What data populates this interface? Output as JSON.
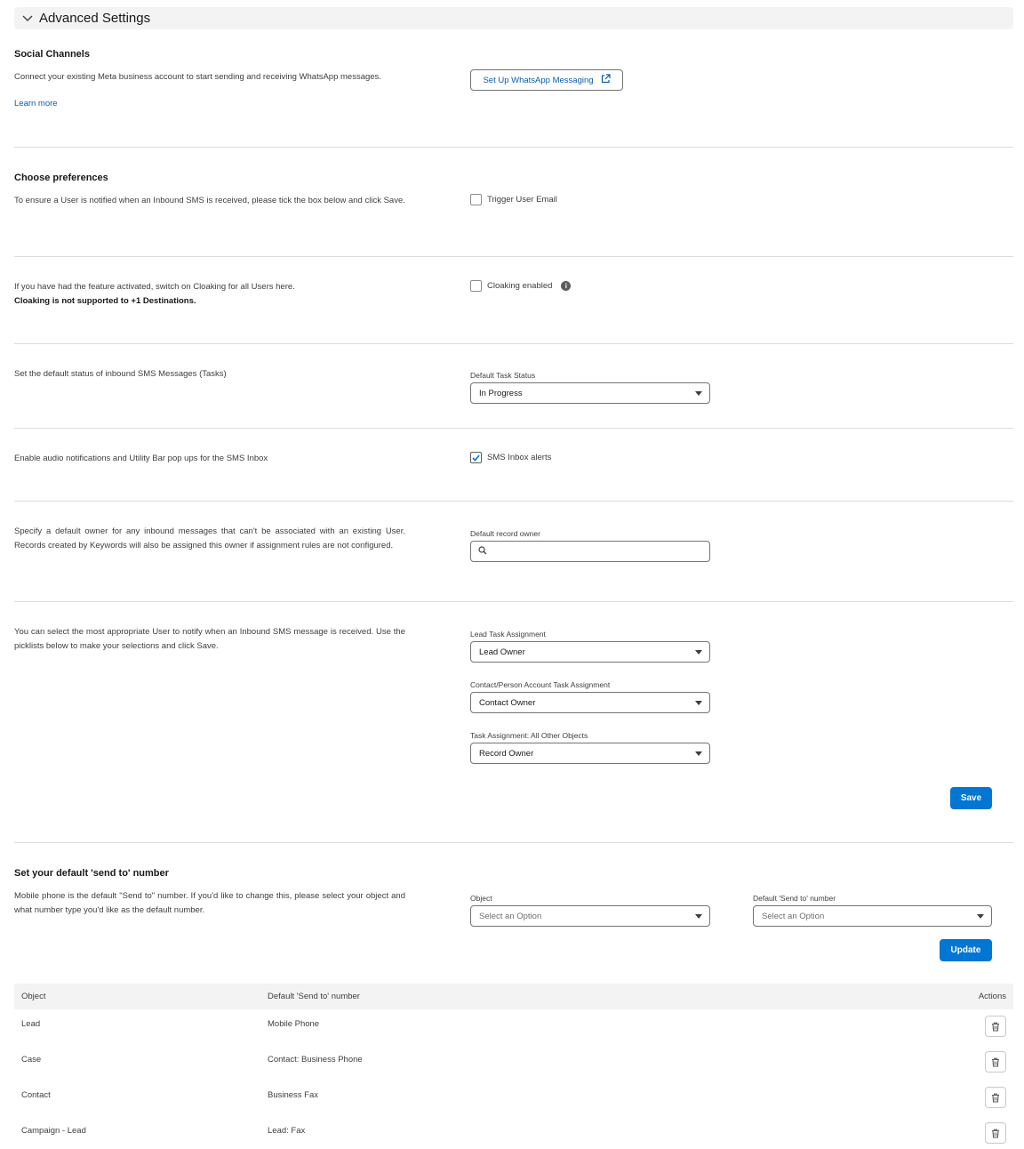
{
  "accordion": {
    "title": "Advanced Settings"
  },
  "social": {
    "title": "Social Channels",
    "description": "Connect your existing Meta business account to start sending and receiving WhatsApp messages.",
    "learn_more": "Learn more",
    "button_label": "Set Up WhatsApp Messaging"
  },
  "preferences": {
    "title": "Choose preferences",
    "description": "To ensure a User is notified when an Inbound SMS is received, please tick the box below and click Save.",
    "checkbox_label": "Trigger User Email",
    "checked": false
  },
  "cloaking": {
    "description": "If you have had the feature activated, switch on Cloaking for all Users here.",
    "note": "Cloaking is not supported to +1 Destinations.",
    "checkbox_label": "Cloaking enabled",
    "checked": false,
    "info_glyph": "i"
  },
  "task_status": {
    "description": "Set the default status of inbound SMS Messages (Tasks)",
    "label": "Default Task Status",
    "value": "In Progress"
  },
  "inbox_alerts": {
    "description": "Enable audio notifications and Utility Bar pop ups for the SMS Inbox",
    "checkbox_label": "SMS Inbox alerts",
    "checked": true
  },
  "default_owner": {
    "description": "Specify a default owner for any inbound messages that can't be associated with an existing User. Records created by Keywords will also be assigned this owner if assignment rules are not configured.",
    "label": "Default record owner",
    "value": ""
  },
  "assignment": {
    "description": "You can select the most appropriate User to notify when an Inbound SMS message is received. Use the picklists below to make your selections and click Save.",
    "lead_label": "Lead Task Assignment",
    "lead_value": "Lead Owner",
    "contact_label": "Contact/Person Account Task Assignment",
    "contact_value": "Contact Owner",
    "other_label": "Task Assignment: All Other Objects",
    "other_value": "Record Owner",
    "save_label": "Save"
  },
  "send_to": {
    "title": "Set your default 'send to' number",
    "description": "Mobile phone is the default \"Send to\" number. If you'd like to change this, please select your object and what number type you'd like as the default number.",
    "object_label": "Object",
    "object_placeholder": "Select an Option",
    "number_label": "Default 'Send to' number",
    "number_placeholder": "Select an Option",
    "update_label": "Update"
  },
  "table": {
    "headers": [
      "Object",
      "Default 'Send to' number",
      "Actions"
    ],
    "rows": [
      {
        "object": "Lead",
        "number": "Mobile Phone"
      },
      {
        "object": "Case",
        "number": "Contact: Business Phone"
      },
      {
        "object": "Contact",
        "number": "Business Fax"
      },
      {
        "object": "Campaign - Lead",
        "number": "Lead: Fax"
      }
    ]
  },
  "colors": {
    "brand": "#0176d3",
    "link": "#0b5cab",
    "border": "#747474",
    "divider": "#dddbda"
  }
}
